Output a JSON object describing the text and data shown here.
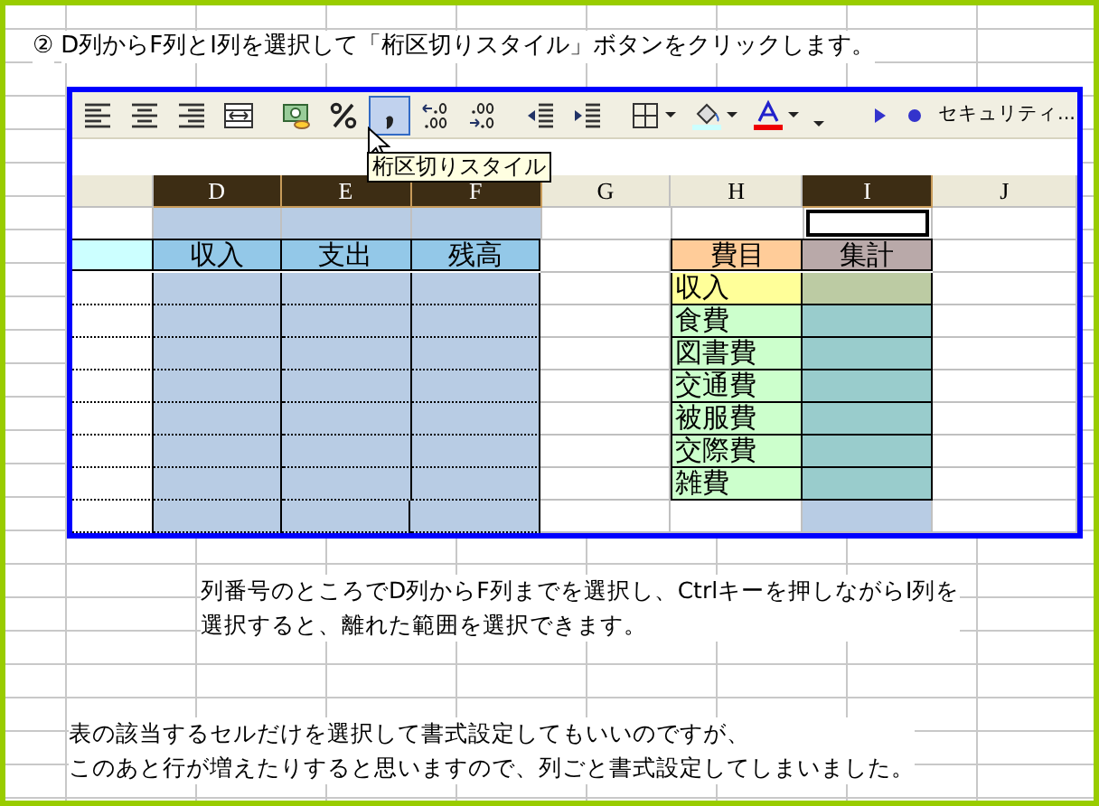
{
  "instruction": {
    "number": "②",
    "text": "D列からF列とI列を選択して「桁区切りスタイル」ボタンをクリックします。"
  },
  "toolbar": {
    "buttons": [
      {
        "kind": "align-left",
        "selected": false,
        "has_menu": false
      },
      {
        "kind": "align-center",
        "selected": false,
        "has_menu": false
      },
      {
        "kind": "align-right",
        "selected": false,
        "has_menu": false
      },
      {
        "kind": "merge",
        "selected": false,
        "has_menu": false
      },
      {
        "kind": "separator"
      },
      {
        "kind": "currency",
        "selected": false,
        "has_menu": false
      },
      {
        "kind": "percent",
        "selected": false,
        "has_menu": false
      },
      {
        "kind": "comma",
        "selected": true,
        "has_menu": false
      },
      {
        "kind": "increase-decimal",
        "selected": false,
        "has_menu": false
      },
      {
        "kind": "decrease-decimal",
        "selected": false,
        "has_menu": false
      },
      {
        "kind": "separator"
      },
      {
        "kind": "outdent",
        "selected": false,
        "has_menu": false
      },
      {
        "kind": "indent",
        "selected": false,
        "has_menu": false
      },
      {
        "kind": "separator"
      },
      {
        "kind": "borders",
        "selected": false,
        "has_menu": true
      },
      {
        "kind": "fill-color",
        "selected": false,
        "has_menu": true
      },
      {
        "kind": "font-color",
        "selected": false,
        "has_menu": true
      },
      {
        "kind": "more",
        "selected": false,
        "has_menu": false
      },
      {
        "kind": "grip"
      },
      {
        "kind": "play",
        "selected": false,
        "has_menu": false
      },
      {
        "kind": "record",
        "selected": false,
        "has_menu": false
      }
    ],
    "overflow_label": "セキュリティ..."
  },
  "tooltip": "桁区切りスタイル",
  "sheet": {
    "columns": [
      {
        "label": "D",
        "selected": true
      },
      {
        "label": "E",
        "selected": true
      },
      {
        "label": "F",
        "selected": true
      },
      {
        "label": "G",
        "selected": false
      },
      {
        "label": "H",
        "selected": false
      },
      {
        "label": "I",
        "selected": true
      },
      {
        "label": "J",
        "selected": false
      }
    ],
    "table_headers": [
      "収入",
      "支出",
      "残高"
    ],
    "category_header": "費目",
    "total_header": "集計",
    "categories": [
      {
        "label": "収入",
        "kind": "income"
      },
      {
        "label": "食費",
        "kind": "expense"
      },
      {
        "label": "図書費",
        "kind": "expense"
      },
      {
        "label": "交通費",
        "kind": "expense"
      },
      {
        "label": "被服費",
        "kind": "expense"
      },
      {
        "label": "交際費",
        "kind": "expense"
      },
      {
        "label": "雑費",
        "kind": "expense"
      }
    ]
  },
  "notes": [
    {
      "lines": [
        "列番号のところでD列からF列までを選択し、Ctrlキーを押しながらI列を",
        "選択すると、離れた範囲を選択できます。"
      ]
    },
    {
      "lines": [
        "表の該当するセルだけを選択して書式設定してもいいのですが、",
        "このあと行が増えたりすると思いますので、列ごと書式設定してしまいました。"
      ]
    }
  ]
}
